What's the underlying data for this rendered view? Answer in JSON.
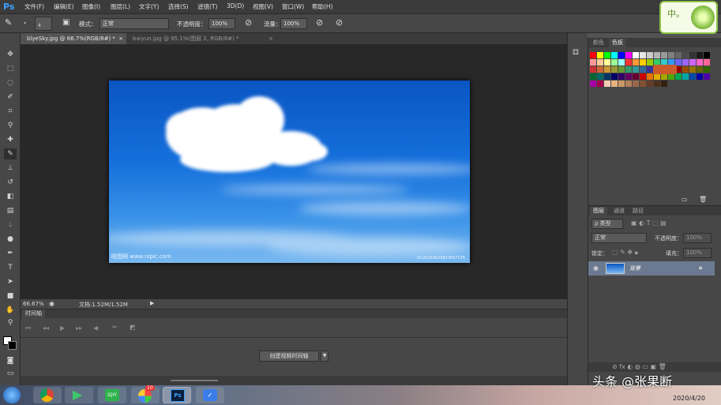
{
  "app": {
    "logo": "Ps"
  },
  "menu": [
    "文件(F)",
    "编辑(E)",
    "图像(I)",
    "图层(L)",
    "文字(Y)",
    "选择(S)",
    "滤镜(T)",
    "3D(D)",
    "视图(V)",
    "窗口(W)",
    "帮助(H)"
  ],
  "options": {
    "brush_size": "4",
    "mode_label": "模式：",
    "mode_value": "正常",
    "opacity_label": "不透明度：",
    "opacity_value": "100%",
    "flow_label": "流量：",
    "flow_value": "100%"
  },
  "tabs": [
    {
      "label": "blyeSky.jpg @ 66.7%(RGB/8#) *"
    },
    {
      "label": "baiyun.jpg @ 95.1%(图层 2, RGB/8#) *"
    }
  ],
  "image": {
    "watermark_left": "昵图网 www.nipic.com",
    "watermark_right": "ID:20150620823057176"
  },
  "status": {
    "zoom": "66.67%",
    "doc": "文档:1.52M/1.52M"
  },
  "timeline": {
    "title": "时间轴",
    "create_button": "创建视频时间轴"
  },
  "swatch_panel": {
    "tabs": [
      "颜色",
      "色板"
    ]
  },
  "swatches": [
    "#ff0000",
    "#ffff00",
    "#00ff00",
    "#00ffff",
    "#0000ff",
    "#ff00ff",
    "#ffffff",
    "#e6e6e6",
    "#cccccc",
    "#b3b3b3",
    "#999999",
    "#808080",
    "#666666",
    "#4d4d4d",
    "#333333",
    "#1a1a1a",
    "#000000",
    "#ff9999",
    "#ffcc99",
    "#ffff99",
    "#99ff99",
    "#99ffff",
    "#ff3333",
    "#ff9933",
    "#ffcc00",
    "#99cc00",
    "#33cc66",
    "#33cccc",
    "#3399ff",
    "#6666ff",
    "#9966ff",
    "#cc66ff",
    "#ff66cc",
    "#ff6699",
    "#cc3333",
    "#cc6633",
    "#cc9933",
    "#999933",
    "#669933",
    "#339966",
    "#339999",
    "#336699",
    "#333399",
    "#663399",
    "#993399",
    "#993366",
    "#990000",
    "#994c00",
    "#997300",
    "#666600",
    "#336600",
    "#006633",
    "#006666",
    "#003366",
    "#000066",
    "#330066",
    "#660066",
    "#660033",
    "#cc0000",
    "#e67300",
    "#e6ac00",
    "#a6a600",
    "#4da600",
    "#00a64d",
    "#00a6a6",
    "#004da6",
    "#0000a6",
    "#4d00a6",
    "#a600a6",
    "#a6004d",
    "#f2ccb3",
    "#e6b380",
    "#cc9966",
    "#b38059",
    "#99664d",
    "#805033",
    "#663d26",
    "#4d2e1a",
    "#33200f"
  ],
  "layers": {
    "tabs": [
      "图层",
      "通道",
      "路径"
    ],
    "filter": "ρ 类型",
    "blend": "正常",
    "opacity_label": "不透明度：",
    "opacity_value": "100%",
    "lock_label": "锁定：",
    "fill_label": "填充：",
    "fill_value": "100%",
    "items": [
      {
        "name": "背景"
      }
    ]
  },
  "taskbar": {
    "badge_count": "10"
  },
  "overlay": {
    "watermark": "头条 @张果断",
    "date": "2020/4/20",
    "corner_text": "中。"
  },
  "colors": {
    "accent": "#3ba0ff",
    "sky_top": "#0a55c4",
    "sky_bottom": "#79b9f0"
  }
}
